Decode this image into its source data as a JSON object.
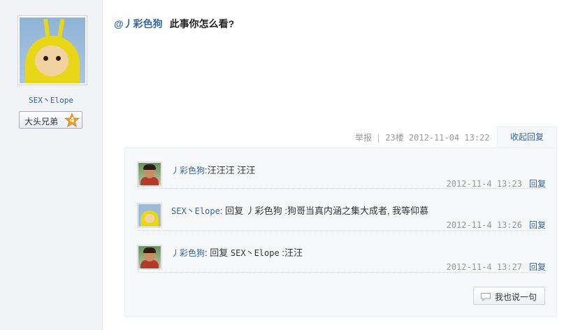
{
  "author": {
    "name": "SEX丶Elope",
    "badge_label": "大头兄弟",
    "badge_level": "4"
  },
  "post": {
    "mention": "@丿彩色狗",
    "body": "此事你怎么看?"
  },
  "post_meta": {
    "report_label": "举报",
    "separator": "|",
    "floor": "23楼",
    "datetime": "2012-11-04 13:22",
    "collapse_label": "收起回复"
  },
  "replies": [
    {
      "author": "丿彩色狗",
      "colon": ":",
      "text": "汪汪汪 汪汪",
      "time": "2012-11-4 13:23",
      "reply_label": "回复"
    },
    {
      "author": "SEX丶Elope",
      "colon": ":",
      "prefix": "回复",
      "target": "丿彩色狗",
      "text": ":狗哥当真内涵之集大成者, 我等仰慕",
      "time": "2012-11-4 13:26",
      "reply_label": "回复"
    },
    {
      "author": "丿彩色狗",
      "colon": ":",
      "prefix": "回复",
      "target": "SEX丶Elope",
      "text": ":汪汪",
      "time": "2012-11-4 13:27",
      "reply_label": "回复"
    }
  ],
  "say_button_label": "我也说一句",
  "colors": {
    "link": "#336699",
    "meta": "#999999",
    "sidebar_bg": "#f1f3f7"
  }
}
